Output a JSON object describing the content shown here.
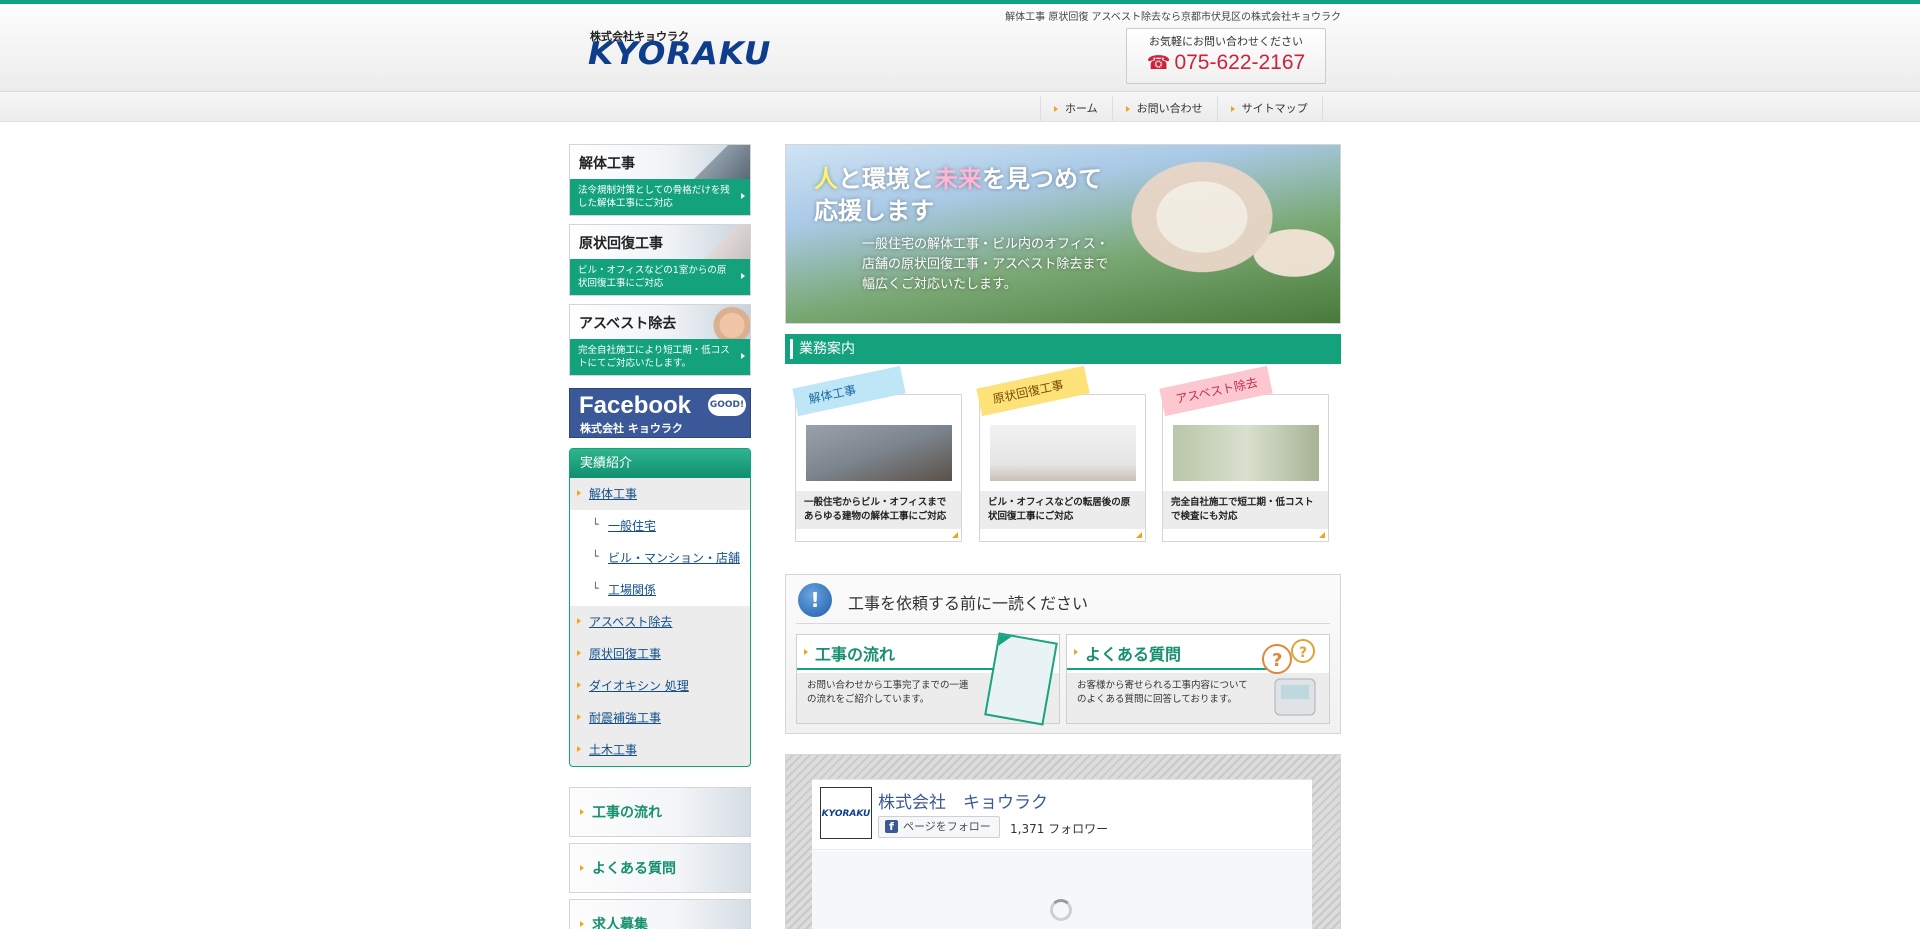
{
  "header": {
    "tagline": "解体工事 原状回復 アスベスト除去なら京都市伏見区の株式会社キョウラク",
    "logo_small": "株式会社キョウラク",
    "logo_big": "KYORAKU",
    "contact_label": "お気軽にお問い合わせください",
    "phone": "075-622-2167",
    "phone_icon": "☎"
  },
  "nav": {
    "items": [
      "ホーム",
      "お問い合わせ",
      "サイトマップ"
    ]
  },
  "sidebar": {
    "services": [
      {
        "title": "解体工事",
        "desc": "法令規制対策としての骨格だけを残した解体工事にご対応"
      },
      {
        "title": "原状回復工事",
        "desc": "ビル・オフィスなどの1室からの原状回復工事にご対応"
      },
      {
        "title": "アスベスト除去",
        "desc": "完全自社施工により短工期・低コストにてご対応いたします。"
      }
    ],
    "facebook": {
      "title": "Facebook",
      "sub": "株式会社 キョウラク",
      "badge": "GOOD!"
    },
    "works": {
      "heading": "実績紹介",
      "items": [
        "解体工事",
        "一般住宅",
        "ビル・マンション・店舗",
        "工場関係",
        "アスベスト除去",
        "原状回復工事",
        "ダイオキシン 処理",
        "耐震補強工事",
        "土木工事"
      ]
    },
    "buttons": [
      "工事の流れ",
      "よくある質問",
      "求人募集"
    ]
  },
  "hero": {
    "line1_a": "人",
    "line1_b": "と",
    "line1_c": "環境",
    "line1_d": "と",
    "line1_e": "未来",
    "line1_f": "を見つめて",
    "line2": "応援します",
    "para1": "一般住宅の解体工事・ビル内のオフィス・",
    "para2": "店舗の原状回復工事・アスベスト除去まで",
    "para3": "幅広くご対応いたします。"
  },
  "business": {
    "heading": "業務案内",
    "cards": [
      {
        "tag": "解体工事",
        "desc": "一般住宅からビル・オフィスまであらゆる建物の解体工事にご対応"
      },
      {
        "tag": "原状回復工事",
        "desc": "ビル・オフィスなどの転居後の原状回復工事にご対応"
      },
      {
        "tag": "アスベスト除去",
        "desc": "完全自社施工で短工期・低コストで検査にも対応"
      }
    ]
  },
  "notice": {
    "icon": "!",
    "title": "工事を依頼する前に一読ください",
    "boxes": [
      {
        "title": "工事の流れ",
        "desc": "お問い合わせから工事完了までの一連の流れをご紹介しています。"
      },
      {
        "title": "よくある質問",
        "desc": "お客様から寄せられる工事内容についてのよくある質問に回答しております。"
      }
    ]
  },
  "fb_widget": {
    "logo": "KYORAKU",
    "page_name": "株式会社　キョウラク",
    "follow_label": "ページをフォロー",
    "followers": "1,371 フォロワー"
  }
}
